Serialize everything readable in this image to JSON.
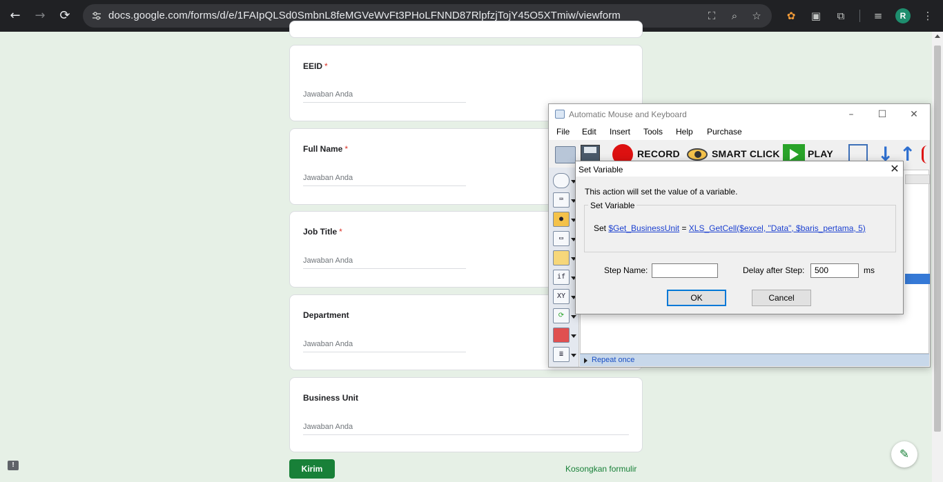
{
  "browser": {
    "url": "docs.google.com/forms/d/e/1FAIpQLSd0SmbnL8feMGVeWvFt3PHoLFNND87RlpfzjTojY45O5XTmiw/viewform",
    "nav": {
      "back": "←",
      "forward": "→",
      "reload": "⟳"
    },
    "avatar_letter": "R"
  },
  "form": {
    "questions": [
      {
        "title": "EEID",
        "required": true,
        "placeholder": "Jawaban Anda"
      },
      {
        "title": "Full Name",
        "required": true,
        "placeholder": "Jawaban Anda"
      },
      {
        "title": "Job Title",
        "required": true,
        "placeholder": "Jawaban Anda"
      },
      {
        "title": "Department",
        "required": false,
        "placeholder": "Jawaban Anda"
      },
      {
        "title": "Business Unit",
        "required": false,
        "placeholder": "Jawaban Anda"
      }
    ],
    "required_mark": "*",
    "submit_label": "Kirim",
    "clear_label": "Kosongkan formulir"
  },
  "amk": {
    "title": "Automatic Mouse and Keyboard",
    "menu": [
      "File",
      "Edit",
      "Insert",
      "Tools",
      "Help",
      "Purchase"
    ],
    "toolbar": {
      "record": "RECORD",
      "smart_click": "SMART CLICK",
      "play": "PLAY"
    },
    "sidebar": {
      "if": "if",
      "xy": "XY"
    },
    "status": "Repeat once"
  },
  "dialog": {
    "title": "Set Variable",
    "description": "This action will set the value of a variable.",
    "group_label": "Set Variable",
    "set_prefix": "Set",
    "variable": "$Get_BusinessUnit",
    "equals": "=",
    "expression": "XLS_GetCell($excel, \"Data\", $baris_pertama, 5)",
    "step_name_label": "Step Name:",
    "step_name_value": "",
    "delay_label": "Delay after Step:",
    "delay_value": "500",
    "delay_unit": "ms",
    "ok_label": "OK",
    "cancel_label": "Cancel"
  },
  "colors": {
    "form_accent": "#188038",
    "page_bg": "#e6f0e6",
    "link": "#1a3fd0"
  }
}
